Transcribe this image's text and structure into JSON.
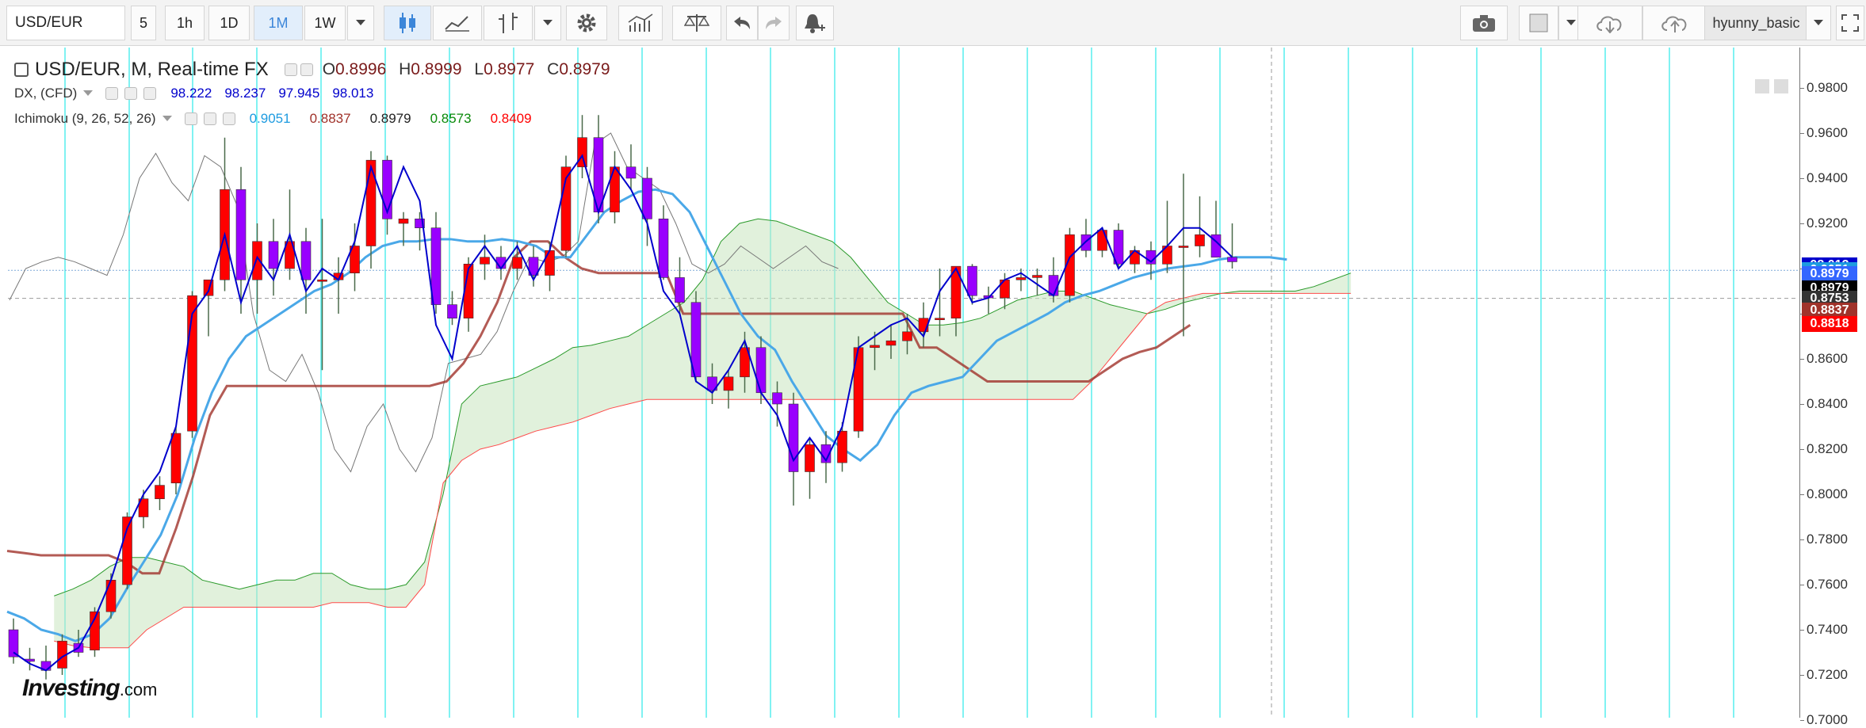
{
  "toolbar": {
    "symbol": "USD/EUR",
    "intervals": [
      "5",
      "1h",
      "1D",
      "1M",
      "1W"
    ],
    "active_interval": "1M",
    "user": "hyunny_basic",
    "icons": [
      "candles-icon",
      "line-chart-icon",
      "bar-style-icon",
      "settings-icon",
      "indicators-icon",
      "compare-icon",
      "undo-icon",
      "redo-icon",
      "alert-icon",
      "camera-icon",
      "color-box-icon",
      "cloud-download-icon",
      "cloud-upload-icon",
      "fullscreen-icon"
    ]
  },
  "legend": {
    "main": {
      "title": "USD/EUR, M, Real-time FX",
      "o_label": "O",
      "o": "0.8996",
      "h_label": "H",
      "h": "0.8999",
      "l_label": "L",
      "l": "0.8977",
      "c_label": "C",
      "c": "0.8979"
    },
    "dx": {
      "title": "DX, (CFD)",
      "v1": "98.222",
      "v2": "98.237",
      "v3": "97.945",
      "v4": "98.013"
    },
    "ichimoku": {
      "title": "Ichimoku (9, 26, 52, 26)",
      "v1": "0.9051",
      "v2": "0.8837",
      "v3": "0.8979",
      "v4": "0.8573",
      "v5": "0.8409"
    }
  },
  "colors": {
    "up": "#ff0000",
    "down": "#9900ff",
    "dx": "#0000cc",
    "tenkan": "#4aa8e8",
    "kijun": "#a0322a",
    "chikou": "#777777",
    "vgrid": "#00e5e5"
  },
  "price_axis": {
    "ticks": [
      "0.9800",
      "0.9600",
      "0.9400",
      "0.9200",
      "0.9000",
      "0.8800",
      "0.8600",
      "0.8400",
      "0.8200",
      "0.8000",
      "0.7800",
      "0.7600",
      "0.7400",
      "0.7200",
      "0.7000"
    ],
    "tags": [
      {
        "text": "98.013",
        "color": "#0000cc",
        "value": 0.9013
      },
      {
        "text": "0.9051",
        "color": "#1e9be0",
        "value": 0.8992
      },
      {
        "text": "0.8979",
        "color": "#3366ff",
        "value": 0.8974
      },
      {
        "text": "0.8979",
        "color": "#000000",
        "value": 0.8914
      },
      {
        "text": "0.8753",
        "color": "#333333",
        "value": 0.8868
      },
      {
        "text": "0.8837",
        "color": "#a0322a",
        "value": 0.8814
      },
      {
        "text": "0.8818",
        "color": "#ff0000",
        "value": 0.8755
      }
    ]
  },
  "logo": {
    "brand": "Investing",
    "suffix": ".com"
  },
  "chart_data": {
    "type": "candlestick",
    "title": "USD/EUR, M, Real-time FX",
    "ylim": [
      0.7,
      0.99
    ],
    "candles": [
      [
        0.74,
        0.745,
        0.725,
        0.728
      ],
      [
        0.727,
        0.732,
        0.722,
        0.726
      ],
      [
        0.726,
        0.733,
        0.718,
        0.722
      ],
      [
        0.723,
        0.738,
        0.72,
        0.735
      ],
      [
        0.734,
        0.74,
        0.728,
        0.73
      ],
      [
        0.731,
        0.75,
        0.728,
        0.748
      ],
      [
        0.748,
        0.765,
        0.745,
        0.762
      ],
      [
        0.76,
        0.792,
        0.758,
        0.79
      ],
      [
        0.79,
        0.802,
        0.785,
        0.798
      ],
      [
        0.798,
        0.808,
        0.793,
        0.804
      ],
      [
        0.805,
        0.83,
        0.8,
        0.827
      ],
      [
        0.828,
        0.89,
        0.825,
        0.888
      ],
      [
        0.888,
        0.895,
        0.87,
        0.895
      ],
      [
        0.895,
        0.958,
        0.89,
        0.935
      ],
      [
        0.935,
        0.945,
        0.88,
        0.895
      ],
      [
        0.895,
        0.92,
        0.88,
        0.912
      ],
      [
        0.912,
        0.922,
        0.888,
        0.9
      ],
      [
        0.9,
        0.935,
        0.895,
        0.912
      ],
      [
        0.912,
        0.918,
        0.88,
        0.895
      ],
      [
        0.895,
        0.922,
        0.855,
        0.895
      ],
      [
        0.895,
        0.905,
        0.88,
        0.898
      ],
      [
        0.898,
        0.92,
        0.89,
        0.91
      ],
      [
        0.91,
        0.952,
        0.9,
        0.948
      ],
      [
        0.948,
        0.95,
        0.915,
        0.922
      ],
      [
        0.92,
        0.925,
        0.91,
        0.922
      ],
      [
        0.922,
        0.925,
        0.908,
        0.918
      ],
      [
        0.918,
        0.925,
        0.88,
        0.884
      ],
      [
        0.884,
        0.89,
        0.875,
        0.878
      ],
      [
        0.878,
        0.905,
        0.872,
        0.902
      ],
      [
        0.902,
        0.915,
        0.895,
        0.905
      ],
      [
        0.905,
        0.91,
        0.895,
        0.9
      ],
      [
        0.9,
        0.912,
        0.895,
        0.905
      ],
      [
        0.905,
        0.91,
        0.892,
        0.897
      ],
      [
        0.897,
        0.912,
        0.89,
        0.908
      ],
      [
        0.908,
        0.95,
        0.905,
        0.945
      ],
      [
        0.945,
        0.968,
        0.94,
        0.958
      ],
      [
        0.958,
        0.968,
        0.92,
        0.925
      ],
      [
        0.925,
        0.952,
        0.92,
        0.945
      ],
      [
        0.945,
        0.955,
        0.935,
        0.94
      ],
      [
        0.94,
        0.945,
        0.91,
        0.922
      ],
      [
        0.922,
        0.928,
        0.895,
        0.896
      ],
      [
        0.896,
        0.905,
        0.88,
        0.885
      ],
      [
        0.885,
        0.89,
        0.85,
        0.852
      ],
      [
        0.852,
        0.858,
        0.84,
        0.846
      ],
      [
        0.846,
        0.855,
        0.838,
        0.852
      ],
      [
        0.852,
        0.872,
        0.845,
        0.865
      ],
      [
        0.865,
        0.87,
        0.84,
        0.845
      ],
      [
        0.845,
        0.85,
        0.83,
        0.84
      ],
      [
        0.84,
        0.845,
        0.795,
        0.81
      ],
      [
        0.81,
        0.825,
        0.798,
        0.822
      ],
      [
        0.822,
        0.828,
        0.805,
        0.814
      ],
      [
        0.814,
        0.832,
        0.81,
        0.828
      ],
      [
        0.828,
        0.87,
        0.825,
        0.865
      ],
      [
        0.865,
        0.872,
        0.855,
        0.866
      ],
      [
        0.866,
        0.875,
        0.86,
        0.868
      ],
      [
        0.868,
        0.88,
        0.862,
        0.872
      ],
      [
        0.872,
        0.885,
        0.865,
        0.878
      ],
      [
        0.878,
        0.9,
        0.87,
        0.878
      ],
      [
        0.878,
        0.901,
        0.87,
        0.901
      ],
      [
        0.901,
        0.902,
        0.884,
        0.888
      ],
      [
        0.888,
        0.892,
        0.88,
        0.887
      ],
      [
        0.887,
        0.898,
        0.882,
        0.895
      ],
      [
        0.895,
        0.9,
        0.89,
        0.896
      ],
      [
        0.896,
        0.9,
        0.888,
        0.897
      ],
      [
        0.897,
        0.905,
        0.885,
        0.888
      ],
      [
        0.888,
        0.918,
        0.885,
        0.915
      ],
      [
        0.915,
        0.922,
        0.905,
        0.908
      ],
      [
        0.908,
        0.918,
        0.905,
        0.917
      ],
      [
        0.917,
        0.92,
        0.9,
        0.902
      ],
      [
        0.902,
        0.91,
        0.898,
        0.908
      ],
      [
        0.908,
        0.912,
        0.895,
        0.902
      ],
      [
        0.902,
        0.93,
        0.898,
        0.91
      ],
      [
        0.91,
        0.942,
        0.87,
        0.91
      ],
      [
        0.91,
        0.932,
        0.905,
        0.915
      ],
      [
        0.915,
        0.93,
        0.908,
        0.905
      ],
      [
        0.905,
        0.92,
        0.9,
        0.903
      ]
    ],
    "dx_line": [
      0.73,
      0.725,
      0.722,
      0.728,
      0.732,
      0.745,
      0.762,
      0.785,
      0.8,
      0.81,
      0.83,
      0.88,
      0.89,
      0.915,
      0.885,
      0.905,
      0.895,
      0.915,
      0.89,
      0.9,
      0.895,
      0.912,
      0.945,
      0.925,
      0.945,
      0.93,
      0.875,
      0.86,
      0.9,
      0.91,
      0.9,
      0.91,
      0.895,
      0.908,
      0.94,
      0.95,
      0.925,
      0.945,
      0.935,
      0.92,
      0.89,
      0.88,
      0.85,
      0.845,
      0.855,
      0.868,
      0.845,
      0.835,
      0.815,
      0.825,
      0.815,
      0.83,
      0.865,
      0.87,
      0.875,
      0.878,
      0.87,
      0.89,
      0.9,
      0.885,
      0.887,
      0.895,
      0.898,
      0.893,
      0.888,
      0.905,
      0.912,
      0.918,
      0.9,
      0.908,
      0.903,
      0.91,
      0.918,
      0.918,
      0.912,
      0.905
    ],
    "tenkan": [
      0.748,
      0.745,
      0.74,
      0.738,
      0.735,
      0.738,
      0.745,
      0.758,
      0.77,
      0.782,
      0.8,
      0.825,
      0.845,
      0.86,
      0.87,
      0.875,
      0.88,
      0.885,
      0.89,
      0.893,
      0.898,
      0.905,
      0.91,
      0.912,
      0.912,
      0.913,
      0.913,
      0.912,
      0.912,
      0.913,
      0.912,
      0.91,
      0.905,
      0.905,
      0.915,
      0.925,
      0.93,
      0.934,
      0.935,
      0.933,
      0.925,
      0.91,
      0.895,
      0.88,
      0.87,
      0.864,
      0.85,
      0.838,
      0.826,
      0.82,
      0.815,
      0.822,
      0.835,
      0.845,
      0.848,
      0.85,
      0.852,
      0.86,
      0.868,
      0.872,
      0.876,
      0.88,
      0.885,
      0.888,
      0.89,
      0.893,
      0.896,
      0.898,
      0.9,
      0.901,
      0.902,
      0.904,
      0.905,
      0.905,
      0.905,
      0.904
    ],
    "kijun": [
      0.7749,
      0.774,
      0.773,
      0.773,
      0.773,
      0.773,
      0.773,
      0.77,
      0.765,
      0.765,
      0.785,
      0.808,
      0.835,
      0.848,
      0.848,
      0.848,
      0.848,
      0.848,
      0.848,
      0.848,
      0.848,
      0.848,
      0.848,
      0.848,
      0.848,
      0.848,
      0.85,
      0.858,
      0.87,
      0.885,
      0.905,
      0.912,
      0.912,
      0.905,
      0.9,
      0.898,
      0.898,
      0.898,
      0.898,
      0.898,
      0.88,
      0.88,
      0.88,
      0.88,
      0.88,
      0.88,
      0.88,
      0.88,
      0.88,
      0.88,
      0.88,
      0.88,
      0.88,
      0.88,
      0.865,
      0.865,
      0.86,
      0.855,
      0.85,
      0.85,
      0.85,
      0.85,
      0.85,
      0.85,
      0.85,
      0.855,
      0.86,
      0.863,
      0.865,
      0.87,
      0.875
    ],
    "senkou_a": [
      0.755,
      0.758,
      0.762,
      0.768,
      0.772,
      0.772,
      0.77,
      0.768,
      0.762,
      0.76,
      0.758,
      0.76,
      0.762,
      0.762,
      0.765,
      0.765,
      0.76,
      0.758,
      0.758,
      0.76,
      0.77,
      0.8,
      0.84,
      0.848,
      0.85,
      0.852,
      0.856,
      0.86,
      0.865,
      0.866,
      0.868,
      0.87,
      0.875,
      0.88,
      0.885,
      0.895,
      0.912,
      0.92,
      0.922,
      0.921,
      0.918,
      0.915,
      0.912,
      0.905,
      0.895,
      0.885,
      0.88,
      0.875,
      0.875,
      0.876,
      0.878,
      0.882,
      0.886,
      0.888,
      0.89,
      0.89,
      0.887,
      0.884,
      0.882,
      0.88,
      0.882,
      0.885,
      0.887,
      0.889,
      0.89,
      0.89,
      0.89,
      0.89,
      0.892,
      0.895,
      0.898
    ],
    "senkou_b": [
      0.735,
      0.733,
      0.732,
      0.732,
      0.732,
      0.74,
      0.745,
      0.75,
      0.75,
      0.75,
      0.75,
      0.75,
      0.75,
      0.75,
      0.75,
      0.752,
      0.752,
      0.752,
      0.75,
      0.75,
      0.76,
      0.805,
      0.815,
      0.82,
      0.822,
      0.825,
      0.828,
      0.83,
      0.832,
      0.835,
      0.838,
      0.84,
      0.842,
      0.842,
      0.842,
      0.842,
      0.842,
      0.842,
      0.842,
      0.842,
      0.842,
      0.842,
      0.842,
      0.842,
      0.842,
      0.842,
      0.842,
      0.842,
      0.842,
      0.842,
      0.842,
      0.842,
      0.842,
      0.842,
      0.842,
      0.842,
      0.85,
      0.86,
      0.87,
      0.88,
      0.885,
      0.887,
      0.889,
      0.889,
      0.889,
      0.889,
      0.889,
      0.889,
      0.889,
      0.889,
      0.889
    ],
    "chikou": [
      0.886,
      0.9,
      0.903,
      0.905,
      0.903,
      0.9,
      0.897,
      0.915,
      0.94,
      0.951,
      0.938,
      0.93,
      0.95,
      0.945,
      0.928,
      0.88,
      0.855,
      0.85,
      0.862,
      0.845,
      0.82,
      0.81,
      0.83,
      0.84,
      0.82,
      0.81,
      0.825,
      0.858,
      0.86,
      0.862,
      0.872,
      0.89,
      0.905,
      0.903,
      0.905,
      0.912,
      0.955,
      0.96,
      0.945,
      0.94,
      0.935,
      0.92,
      0.902,
      0.898,
      0.902,
      0.91,
      0.905,
      0.9,
      0.905,
      0.91,
      0.903,
      0.9
    ]
  }
}
